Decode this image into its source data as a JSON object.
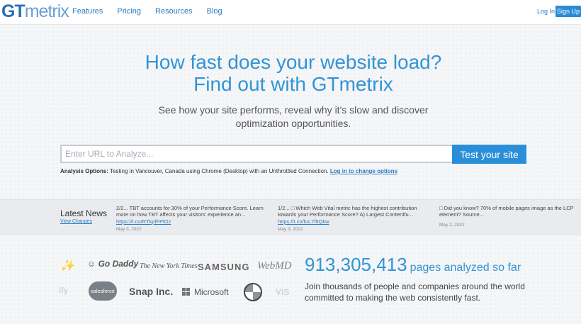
{
  "header": {
    "logo": {
      "part1": "GT",
      "part2": "metrix"
    },
    "nav": [
      "Features",
      "Pricing",
      "Resources",
      "Blog"
    ],
    "login": "Log In",
    "signup": "Sign Up"
  },
  "hero": {
    "title_line1": "How fast does your website load?",
    "title_line2": "Find out with GTmetrix",
    "subtitle_line1": "See how your site performs, reveal why it's slow and discover",
    "subtitle_line2": "optimization opportunities.",
    "url_placeholder": "Enter URL to Analyze...",
    "test_button": "Test your site"
  },
  "analysis": {
    "label": "Analysis Options:",
    "text_prefix": "Testing in",
    "location": "Vancouver, Canada",
    "text_using": "using",
    "browser": "Chrome (Desktop)",
    "text_with": "with an",
    "connection": "Unthrottled Connection",
    "link": "Log in to change options"
  },
  "news": {
    "title": "Latest News",
    "view_changes": "View Changes",
    "items": [
      {
        "text": "2/2... TBT accounts for 30% of your Performance Score. Learn more on how TBT affects your visitors' experience an...",
        "link": "https://t.co/RTkpfFPlOz",
        "date": "May 3, 2022"
      },
      {
        "text": "1/2... □ Which Web Vital metric has the highest contribution towards your Performance Score? A) Largest Contentfu...",
        "link": "https://t.co/fuL7f6Qkw",
        "date": "May 3, 2022"
      },
      {
        "text": "□ Did you know? 70% of mobile pages image as the LCP element? Source...",
        "link": "",
        "date": "May 2, 2022"
      }
    ]
  },
  "brands": {
    "godaddy": "Go Daddy",
    "nyt": "The New York Times",
    "samsung": "SAMSUNG",
    "webmd": "WebMD",
    "salesforce": "salesforce",
    "snap": "Snap Inc.",
    "microsoft": "Microsoft",
    "faded_left_bottom": "ify",
    "faded_right_bottom": "VIS"
  },
  "stats": {
    "count": "913,305,413",
    "label": "pages analyzed so far",
    "join_line1": "Join thousands of people and companies around the world",
    "join_line2": "committed to making the web consistently fast."
  },
  "colors": {
    "brand_blue": "#3294d6",
    "button_blue": "#2a8fd8",
    "link_blue": "#2a7cc0"
  }
}
